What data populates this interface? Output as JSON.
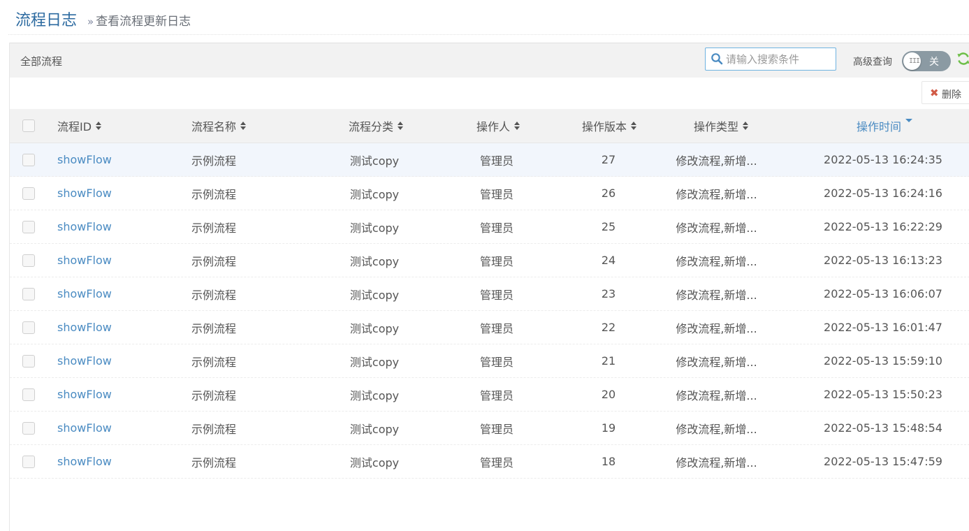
{
  "header": {
    "title": "流程日志",
    "chevron": "»",
    "subtitle": "查看流程更新日志"
  },
  "panel": {
    "title": "全部流程",
    "search": {
      "placeholder": "请输入搜索条件",
      "value": ""
    },
    "advanced_label": "高级查询",
    "toggle": {
      "state_label": "关",
      "knob_glyph": "III",
      "on": false
    },
    "refresh_icon": "refresh-icon",
    "colors": {
      "accent": "#4a8bc2",
      "toggle_bg": "#8b9aa3",
      "refresh": "#6fbf4a",
      "delete": "#d15b47"
    }
  },
  "toolbar": {
    "delete_icon": "✖",
    "delete_label": "删除"
  },
  "table": {
    "columns": [
      {
        "label": "流程ID",
        "sort": "both"
      },
      {
        "label": "流程名称",
        "sort": "both"
      },
      {
        "label": "流程分类",
        "sort": "both"
      },
      {
        "label": "操作人",
        "sort": "both"
      },
      {
        "label": "操作版本",
        "sort": "both"
      },
      {
        "label": "操作类型",
        "sort": "both"
      },
      {
        "label": "操作时间",
        "sort": "desc"
      }
    ],
    "rows": [
      {
        "id": "showFlow",
        "name": "示例流程",
        "category": "测试copy",
        "operator": "管理员",
        "version": "27",
        "type": "修改流程,新增...",
        "time": "2022-05-13 16:24:35"
      },
      {
        "id": "showFlow",
        "name": "示例流程",
        "category": "测试copy",
        "operator": "管理员",
        "version": "26",
        "type": "修改流程,新增...",
        "time": "2022-05-13 16:24:16"
      },
      {
        "id": "showFlow",
        "name": "示例流程",
        "category": "测试copy",
        "operator": "管理员",
        "version": "25",
        "type": "修改流程,新增...",
        "time": "2022-05-13 16:22:29"
      },
      {
        "id": "showFlow",
        "name": "示例流程",
        "category": "测试copy",
        "operator": "管理员",
        "version": "24",
        "type": "修改流程,新增...",
        "time": "2022-05-13 16:13:23"
      },
      {
        "id": "showFlow",
        "name": "示例流程",
        "category": "测试copy",
        "operator": "管理员",
        "version": "23",
        "type": "修改流程,新增...",
        "time": "2022-05-13 16:06:07"
      },
      {
        "id": "showFlow",
        "name": "示例流程",
        "category": "测试copy",
        "operator": "管理员",
        "version": "22",
        "type": "修改流程,新增...",
        "time": "2022-05-13 16:01:47"
      },
      {
        "id": "showFlow",
        "name": "示例流程",
        "category": "测试copy",
        "operator": "管理员",
        "version": "21",
        "type": "修改流程,新增...",
        "time": "2022-05-13 15:59:10"
      },
      {
        "id": "showFlow",
        "name": "示例流程",
        "category": "测试copy",
        "operator": "管理员",
        "version": "20",
        "type": "修改流程,新增...",
        "time": "2022-05-13 15:50:23"
      },
      {
        "id": "showFlow",
        "name": "示例流程",
        "category": "测试copy",
        "operator": "管理员",
        "version": "19",
        "type": "修改流程,新增...",
        "time": "2022-05-13 15:48:54"
      },
      {
        "id": "showFlow",
        "name": "示例流程",
        "category": "测试copy",
        "operator": "管理员",
        "version": "18",
        "type": "修改流程,新增...",
        "time": "2022-05-13 15:47:59"
      }
    ]
  }
}
